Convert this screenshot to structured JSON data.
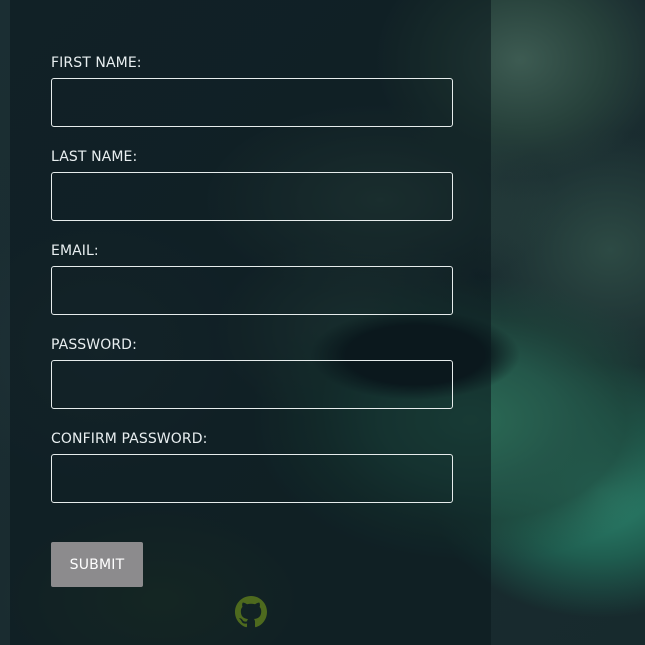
{
  "form": {
    "fields": [
      {
        "label": "FIRST NAME:",
        "value": "",
        "placeholder": ""
      },
      {
        "label": "LAST NAME:",
        "value": "",
        "placeholder": ""
      },
      {
        "label": "EMAIL:",
        "value": "",
        "placeholder": ""
      },
      {
        "label": "PASSWORD:",
        "value": "",
        "placeholder": ""
      },
      {
        "label": "CONFIRM PASSWORD:",
        "value": "",
        "placeholder": ""
      }
    ],
    "submit_label": "SUBMIT"
  },
  "footer": {
    "icon": "github-icon"
  },
  "colors": {
    "panel": "#0a181e",
    "input_border": "#e6ecec",
    "submit_bg": "#8c8b8d",
    "github_icon": "#4e6a1e"
  }
}
